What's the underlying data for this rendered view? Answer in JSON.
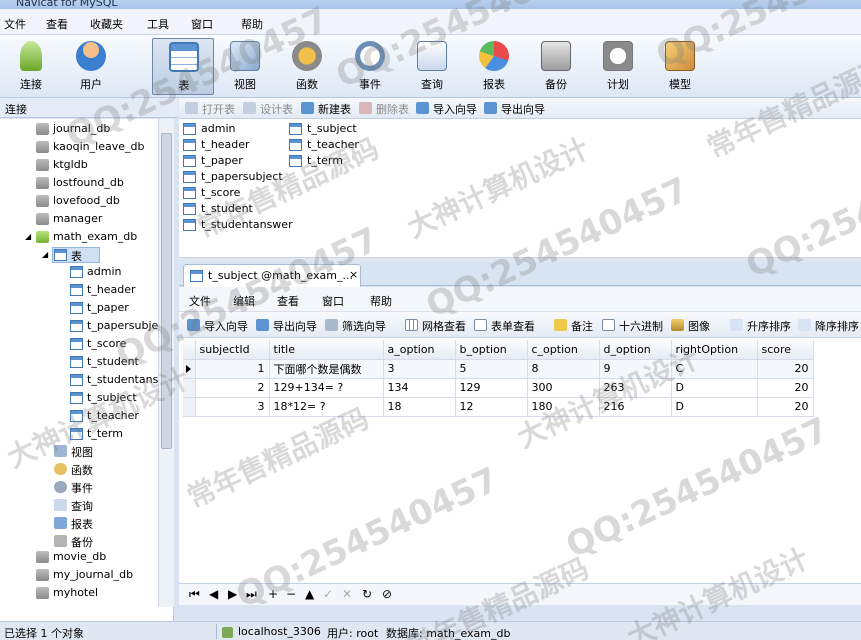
{
  "window": {
    "title": "Navicat for MySQL"
  },
  "menubar": [
    "文件",
    "查看",
    "收藏夹",
    "工具",
    "窗口",
    "帮助"
  ],
  "toolbar": [
    {
      "label": "连接",
      "icon": "connection-icon",
      "active": false
    },
    {
      "label": "用户",
      "icon": "user-icon",
      "active": false
    },
    {
      "label": "表",
      "icon": "table-icon",
      "active": true
    },
    {
      "label": "视图",
      "icon": "view-icon",
      "active": false
    },
    {
      "label": "函数",
      "icon": "function-icon",
      "active": false
    },
    {
      "label": "事件",
      "icon": "event-icon",
      "active": false
    },
    {
      "label": "查询",
      "icon": "query-icon",
      "active": false
    },
    {
      "label": "报表",
      "icon": "report-icon",
      "active": false
    },
    {
      "label": "备份",
      "icon": "backup-icon",
      "active": false
    },
    {
      "label": "计划",
      "icon": "schedule-icon",
      "active": false
    },
    {
      "label": "模型",
      "icon": "model-icon",
      "active": false
    }
  ],
  "connection_pane": {
    "header": "连接",
    "databases_before": [
      "journal_db",
      "kaoqin_leave_db",
      "ktgldb",
      "lostfound_db",
      "lovefood_db",
      "manager"
    ],
    "open_db": "math_exam_db",
    "tables_node": "表",
    "tables": [
      "admin",
      "t_header",
      "t_paper",
      "t_papersubjec",
      "t_score",
      "t_student",
      "t_studentansw",
      "t_subject",
      "t_teacher",
      "t_term"
    ],
    "other_nodes": [
      "视图",
      "函数",
      "事件",
      "查询",
      "报表",
      "备份"
    ],
    "databases_after": [
      "movie_db",
      "my_journal_db",
      "myhotel"
    ]
  },
  "object_toolbar": [
    {
      "label": "打开表",
      "enabled": false
    },
    {
      "label": "设计表",
      "enabled": false
    },
    {
      "label": "新建表",
      "enabled": true
    },
    {
      "label": "删除表",
      "enabled": false
    },
    {
      "label": "导入向导",
      "enabled": true
    },
    {
      "label": "导出向导",
      "enabled": true
    }
  ],
  "object_list": {
    "col1": [
      "admin",
      "t_header",
      "t_paper",
      "t_papersubject",
      "t_score",
      "t_student",
      "t_studentanswer"
    ],
    "col2": [
      "t_subject",
      "t_teacher",
      "t_term"
    ]
  },
  "subwindow": {
    "tab_title": "t_subject @math_exam_...",
    "close": "×",
    "menu": [
      "文件",
      "编辑",
      "查看",
      "窗口",
      "帮助"
    ],
    "tools": [
      "导入向导",
      "导出向导",
      "筛选向导",
      "网格查看",
      "表单查看",
      "备注",
      "十六进制",
      "图像",
      "升序排序",
      "降序排序"
    ]
  },
  "grid": {
    "columns": [
      "subjectId",
      "title",
      "a_option",
      "b_option",
      "c_option",
      "d_option",
      "rightOption",
      "score"
    ],
    "rows": [
      [
        "1",
        "下面哪个数是偶数",
        "3",
        "5",
        "8",
        "9",
        "C",
        "20"
      ],
      [
        "2",
        "129+134= ?",
        "134",
        "129",
        "300",
        "263",
        "D",
        "20"
      ],
      [
        "3",
        "18*12= ?",
        "18",
        "12",
        "180",
        "216",
        "D",
        "20"
      ]
    ]
  },
  "navbar": [
    "⏮",
    "◀",
    "▶",
    "⏭",
    "+",
    "−",
    "▲",
    "✓",
    "✕",
    "↻",
    "⊘"
  ],
  "status": {
    "selection": "已选择 1 个对象",
    "host": "localhost_3306",
    "user": "用户: root",
    "database": "数据库: math_exam_db"
  },
  "watermarks": {
    "qq": "QQ:254540457",
    "a": "常年售精品源码",
    "b": "大神计算机设计"
  },
  "colors": {
    "accent": "#3f79b8",
    "selection": "#cfe0f5",
    "window_bg": "#d9e3f1"
  }
}
